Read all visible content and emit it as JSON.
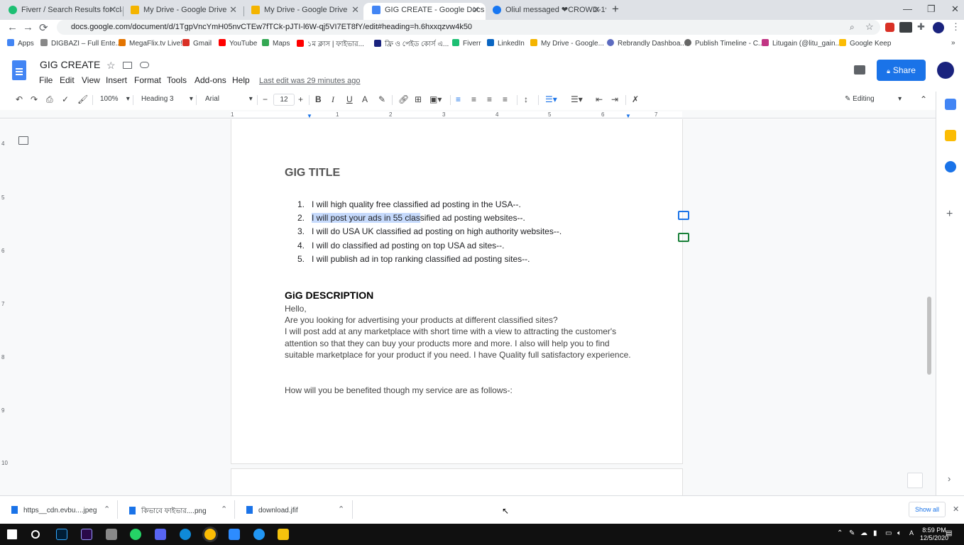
{
  "browser": {
    "tabs": [
      {
        "label": "Fiverr / Search Results for 'classi",
        "color": "#1dbf73"
      },
      {
        "label": "My Drive - Google Drive",
        "color": "#f4b400"
      },
      {
        "label": "My Drive - Google Drive",
        "color": "#f4b400"
      },
      {
        "label": "GIG CREATE - Google Docs",
        "color": "#4285f4",
        "active": true
      },
      {
        "label": "Oliul messaged ❤CROWD-1❤",
        "color": "#1877f2"
      }
    ],
    "new_tab": "+",
    "url": "docs.google.com/document/d/1TgpVncYmH05nvCTEw7fTCk-pJTI-l6W-qj5VI7ET8fY/edit#heading=h.6hxxqzvw4k50",
    "bookmarks": [
      {
        "label": "Apps",
        "color": "#4285f4"
      },
      {
        "label": "DIGBAZI – Full Ente...",
        "color": "#888888"
      },
      {
        "label": "MegaFlix.tv Live!",
        "color": "#e37400"
      },
      {
        "label": "Gmail",
        "color": "#d93025"
      },
      {
        "label": "YouTube",
        "color": "#ff0000"
      },
      {
        "label": "Maps",
        "color": "#34a853"
      },
      {
        "label": "১ম ক্লাস | ফাইভার...",
        "color": "#ff0000"
      },
      {
        "label": "ফ্রি ও পেইড কোর্স এ...",
        "color": "#1a237e"
      },
      {
        "label": "Fiverr",
        "color": "#1dbf73"
      },
      {
        "label": "LinkedIn",
        "color": "#0a66c2"
      },
      {
        "label": "My Drive - Google...",
        "color": "#f4b400"
      },
      {
        "label": "Rebrandly Dashboa...",
        "color": "#5c6bc0"
      },
      {
        "label": "Publish Timeline - C...",
        "color": "#666666"
      },
      {
        "label": "Litugain (@litu_gain...",
        "color": "#c13584"
      },
      {
        "label": "Google Keep",
        "color": "#fbbc04"
      }
    ]
  },
  "docs": {
    "title": "GIG CREATE",
    "menus": [
      "File",
      "Edit",
      "View",
      "Insert",
      "Format",
      "Tools",
      "Add-ons",
      "Help"
    ],
    "last_edit": "Last edit was 29 minutes ago",
    "share": "Share",
    "toolbar": {
      "zoom": "100%",
      "style": "Heading 3",
      "font": "Arial",
      "font_size": "12",
      "mode": "Editing"
    },
    "ruler_numbers": [
      "1",
      "1",
      "2",
      "3",
      "4",
      "5",
      "6",
      "7"
    ],
    "side_ruler_numbers": [
      "4",
      "5",
      "6",
      "7",
      "8",
      "9",
      "10"
    ]
  },
  "document": {
    "gig_title": "GIG TITLE",
    "list": [
      {
        "num": "1.",
        "text": "I will high quality free classified ad posting in the USA--."
      },
      {
        "num": "2.",
        "highlight": "I will post your ads in 55 clas",
        "text": "sified ad posting websites--."
      },
      {
        "num": "3.",
        "text": "I will do USA UK classified ad posting on high authority websites--."
      },
      {
        "num": "4.",
        "text": "I will do classified ad posting on top USA ad sites--."
      },
      {
        "num": "5.",
        "text": "I will publish ad in top ranking classified ad posting sites--."
      }
    ],
    "gig_desc": "GiG DESCRIPTION",
    "hello": "Hello,",
    "p1": "Are you looking for advertising your products at different classified sites?",
    "p2": " I will post add at any marketplace with short time with a view to attracting the customer's attention so that they can buy your products more and more. I also will help you to find suitable marketplace for your product if you need. I have Quality full satisfactory experience.",
    "p3": "How will you be benefited though my service are as follows-:"
  },
  "downloads": {
    "items": [
      "https__cdn.evbu....jpeg",
      "কিভাবে ফাইভার....png",
      "download.jfif"
    ],
    "show_all": "Show all"
  },
  "taskbar": {
    "time": "8:59 PM",
    "date": "12/5/2020"
  }
}
